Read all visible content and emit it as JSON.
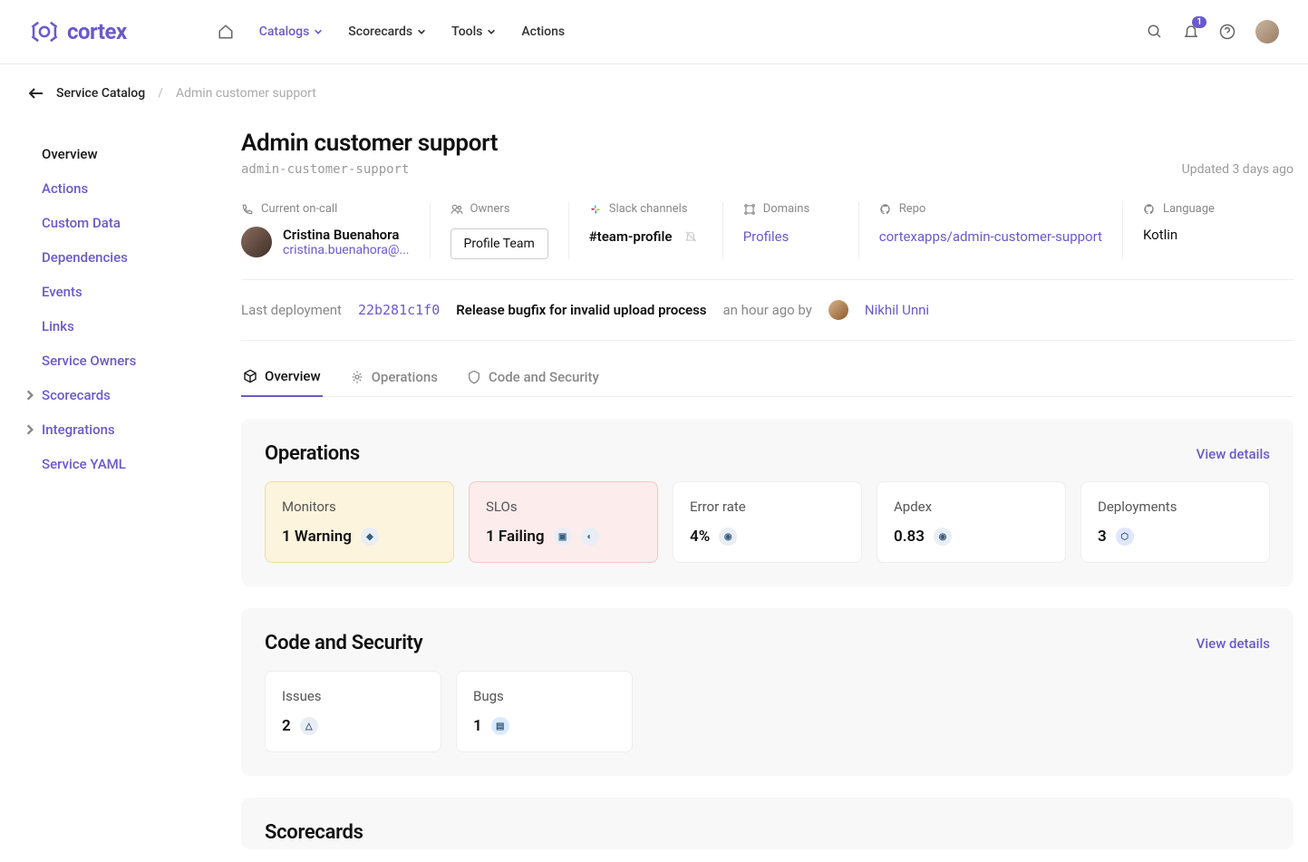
{
  "brand": "cortex",
  "nav": {
    "items": [
      "Catalogs",
      "Scorecards",
      "Tools",
      "Actions"
    ],
    "badge": "1"
  },
  "breadcrumb": {
    "root": "Service Catalog",
    "current": "Admin customer support"
  },
  "sidebar": {
    "items": [
      "Overview",
      "Actions",
      "Custom Data",
      "Dependencies",
      "Events",
      "Links",
      "Service Owners",
      "Scorecards",
      "Integrations",
      "Service YAML"
    ]
  },
  "page": {
    "title": "Admin customer support",
    "slug": "admin-customer-support",
    "updated": "Updated 3 days ago"
  },
  "info": {
    "oncall_label": "Current on-call",
    "oncall_name": "Cristina Buenahora",
    "oncall_email": "cristina.buenahora@...",
    "owners_label": "Owners",
    "owner_chip": "Profile Team",
    "slack_label": "Slack channels",
    "slack_channel": "#team-profile",
    "domains_label": "Domains",
    "domain": "Profiles",
    "repo_label": "Repo",
    "repo": "cortexapps/admin-customer-support",
    "lang_label": "Language",
    "language": "Kotlin"
  },
  "deploy": {
    "label": "Last deployment",
    "commit": "22b281c1f0",
    "message": "Release bugfix for invalid upload process",
    "time": "an hour ago by",
    "user": "Nikhil Unni"
  },
  "tabs": [
    "Overview",
    "Operations",
    "Code and Security"
  ],
  "operations": {
    "title": "Operations",
    "view": "View details",
    "cards": {
      "monitors_label": "Monitors",
      "monitors_val": "1 Warning",
      "slos_label": "SLOs",
      "slos_val": "1 Failing",
      "error_label": "Error rate",
      "error_val": "4%",
      "apdex_label": "Apdex",
      "apdex_val": "0.83",
      "deploy_label": "Deployments",
      "deploy_val": "3"
    }
  },
  "security": {
    "title": "Code and Security",
    "view": "View details",
    "cards": {
      "issues_label": "Issues",
      "issues_val": "2",
      "bugs_label": "Bugs",
      "bugs_val": "1"
    }
  },
  "scorecards": {
    "title": "Scorecards"
  }
}
